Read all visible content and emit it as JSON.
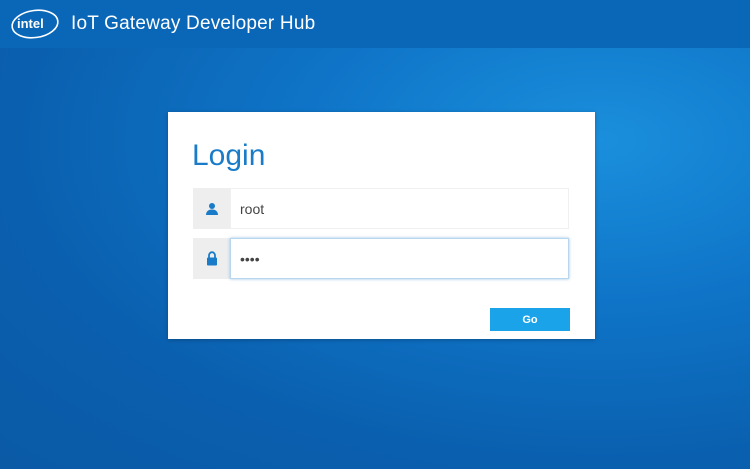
{
  "header": {
    "logo_text": "intel",
    "title": "IoT Gateway Developer Hub"
  },
  "login": {
    "title": "Login",
    "username": {
      "icon": "user-icon",
      "value": "root"
    },
    "password": {
      "icon": "lock-icon",
      "value": "root"
    },
    "submit_label": "Go"
  },
  "colors": {
    "header_bg": "#0a67b8",
    "background": "#0f74c7",
    "title_blue": "#1a7cc8",
    "button_blue": "#1aa3e8",
    "addon_gray": "#eeeeee"
  }
}
